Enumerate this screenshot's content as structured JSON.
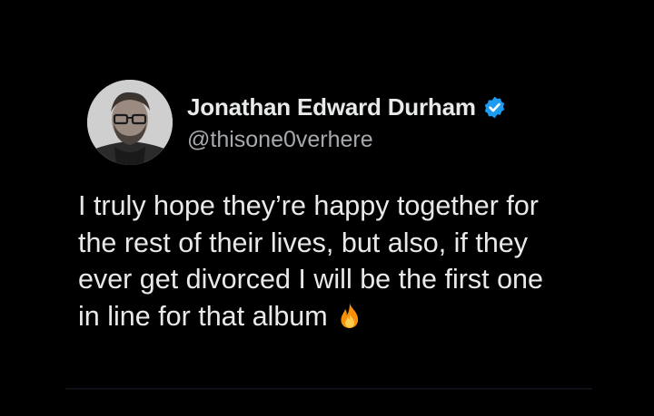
{
  "author": {
    "display_name": "Jonathan Edward Durham",
    "handle": "@thisone0verhere",
    "verified": true,
    "verified_icon": "verified-badge-icon",
    "verified_color": "#1d9bf0"
  },
  "tweet": {
    "lines": [
      "I truly hope they’re happy together for",
      "the rest of their lives, but also, if they",
      "ever get divorced I will be the first one",
      "in line for that album"
    ],
    "emoji": "fire-icon"
  },
  "colors": {
    "background": "#000000",
    "text": "#e7e9ea",
    "secondary_text": "#a6a9ad"
  }
}
